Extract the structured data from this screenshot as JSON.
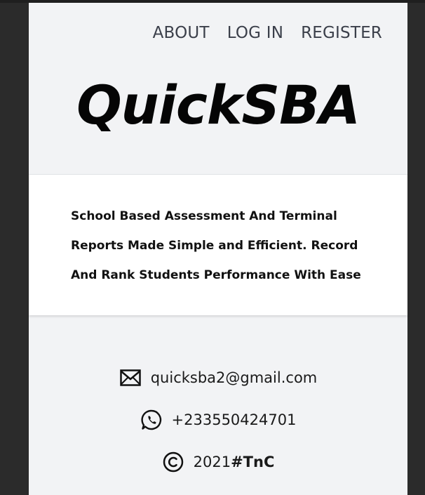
{
  "nav": {
    "items": [
      {
        "label": "ABOUT"
      },
      {
        "label": "LOG IN"
      },
      {
        "label": "REGISTER"
      }
    ]
  },
  "brand": {
    "name": "QuickSBA"
  },
  "hero": {
    "tagline": "School Based Assessment And Terminal Reports Made Simple and Efficient. Record And Rank Students Performance With Ease"
  },
  "contact": {
    "email": "quicksba2@gmail.com",
    "phone": "+233550424701",
    "year": "2021",
    "terms_link": "#TnC",
    "icons": {
      "email": "envelope-icon",
      "phone": "whatsapp-icon",
      "copyright": "copyright-icon"
    }
  },
  "colors": {
    "page_background": "#f2f3f5",
    "hero_background": "#ffffff",
    "outer_background": "#2b2b2b",
    "nav_text": "#3b3f4a",
    "brand_text": "#050505"
  }
}
